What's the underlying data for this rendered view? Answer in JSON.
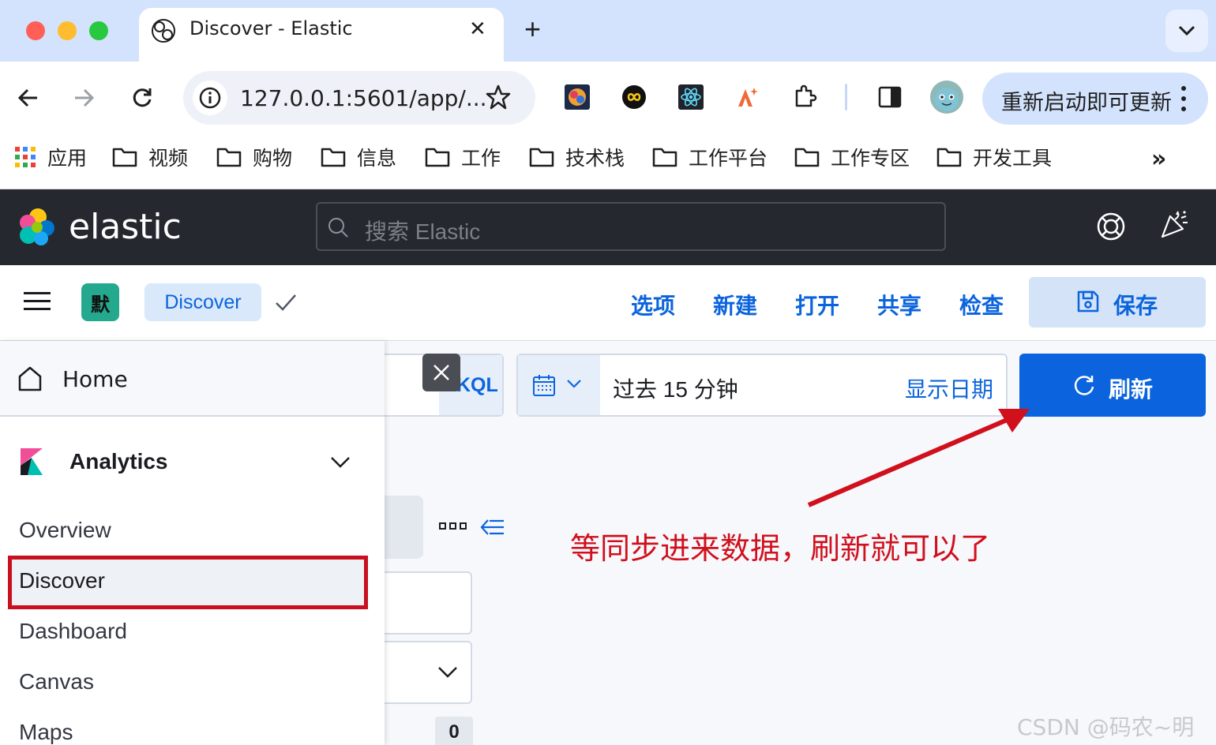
{
  "browser": {
    "tab_title": "Discover - Elastic",
    "tab_close": "✕",
    "new_tab": "+",
    "url": "127.0.0.1:5601/app/...",
    "update_label": "重新启动即可更新",
    "bookmarks": [
      {
        "label": "应用",
        "icon": "apps-grid-icon"
      },
      {
        "label": "视频",
        "icon": "folder-icon"
      },
      {
        "label": "购物",
        "icon": "folder-icon"
      },
      {
        "label": "信息",
        "icon": "folder-icon"
      },
      {
        "label": "工作",
        "icon": "folder-icon"
      },
      {
        "label": "技术栈",
        "icon": "folder-icon"
      },
      {
        "label": "工作平台",
        "icon": "folder-icon"
      },
      {
        "label": "工作专区",
        "icon": "folder-icon"
      },
      {
        "label": "开发工具",
        "icon": "folder-icon"
      }
    ],
    "bookmarks_more": "»"
  },
  "elastic": {
    "brand": "elastic",
    "search_placeholder": "搜索 Elastic"
  },
  "app_bar": {
    "space_initial": "默",
    "breadcrumb": "Discover",
    "menu": [
      "选项",
      "新建",
      "打开",
      "共享",
      "检查"
    ],
    "save_label": "保存"
  },
  "query_bar": {
    "language": "KQL",
    "time_range": "过去 15 分钟",
    "show_dates": "显示日期",
    "refresh_label": "刷新"
  },
  "sidebar": {
    "count_badge": "0"
  },
  "nav": {
    "home": "Home",
    "section": "Analytics",
    "items": [
      "Overview",
      "Discover",
      "Dashboard",
      "Canvas",
      "Maps"
    ],
    "selected": "Discover"
  },
  "annotation": {
    "text": "等同步进来数据，刷新就可以了"
  },
  "watermark": "CSDN @码农~明哥",
  "colors": {
    "accent": "#0b64dd",
    "header_bg": "#25282f",
    "annotation_red": "#d0101c"
  }
}
